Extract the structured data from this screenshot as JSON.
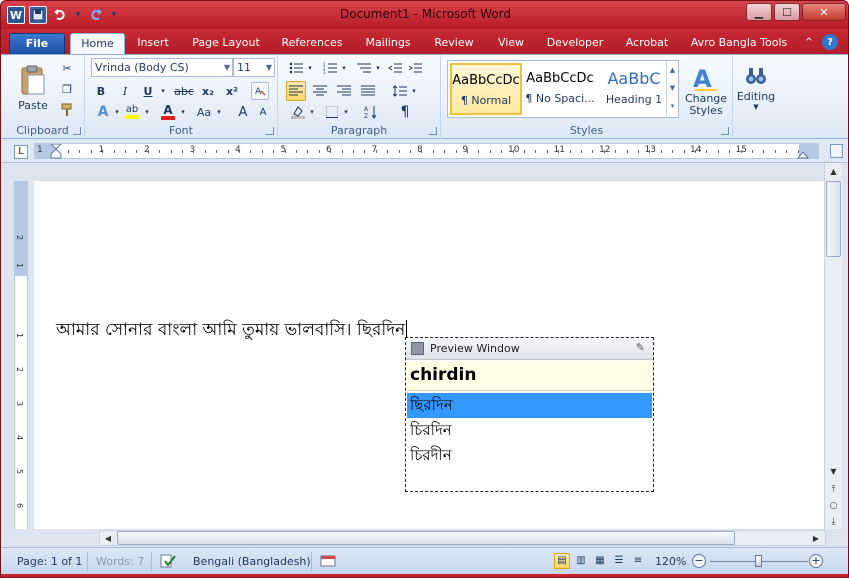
{
  "window": {
    "title": "Document1  -  Microsoft Word",
    "logo_letter": "W",
    "qat": [
      "save-icon",
      "undo-icon",
      "redo-icon",
      "customize-qat-icon"
    ],
    "controls": {
      "minimize": "▁",
      "maximize": "☐",
      "close": "✕"
    }
  },
  "tabs": [
    {
      "label": "File",
      "state": "file"
    },
    {
      "label": "Home",
      "state": "active"
    },
    {
      "label": "Insert"
    },
    {
      "label": "Page Layout"
    },
    {
      "label": "References"
    },
    {
      "label": "Mailings"
    },
    {
      "label": "Review"
    },
    {
      "label": "View"
    },
    {
      "label": "Developer"
    },
    {
      "label": "Acrobat"
    },
    {
      "label": "Avro Bangla Tools"
    }
  ],
  "ribbon": {
    "clipboard": {
      "label": "Clipboard",
      "paste": "Paste"
    },
    "font": {
      "label": "Font",
      "font_name": "Vrinda (Body CS)",
      "font_size": "11",
      "bold": "B",
      "italic": "I",
      "underline": "U",
      "strike": "abc",
      "subscript": "x₂",
      "superscript": "x²",
      "grow": "A",
      "shrink": "A",
      "change_case": "Aa",
      "highlight": "ab",
      "font_color": "A"
    },
    "paragraph": {
      "label": "Paragraph",
      "pilcrow": "¶"
    },
    "styles": {
      "label": "Styles",
      "items": [
        {
          "preview": "AaBbCcDc",
          "name": "¶ Normal"
        },
        {
          "preview": "AaBbCcDc",
          "name": "¶ No Spaci..."
        },
        {
          "preview": "AaBbC",
          "name": "Heading 1"
        }
      ],
      "change_styles": "Change\nStyles"
    },
    "editing": {
      "label": "Editing"
    }
  },
  "ruler": {
    "tab_selector": "L",
    "numbers": [
      "1",
      "1",
      "2",
      "3",
      "4",
      "5",
      "6",
      "7",
      "8",
      "9",
      "10",
      "11",
      "12",
      "13",
      "14",
      "15"
    ]
  },
  "document": {
    "text": "আমার সোনার বাংলা আমি তুমায় ভালবাসি। ছিরদিন"
  },
  "preview_window": {
    "title": "Preview Window",
    "input": "chirdin",
    "suggestions": [
      "ছিরদিন",
      "চিরদিন",
      "চিরদীন"
    ],
    "selected_index": 0
  },
  "status": {
    "page": "Page: 1 of 1",
    "words": "Words: 7",
    "language": "Bengali (Bangladesh)",
    "zoom": "120%",
    "zoom_minus": "−",
    "zoom_plus": "+"
  },
  "colors": {
    "title_bar": "#c8222c",
    "file_tab": "#2b5aa8",
    "selection": "#3399ff",
    "preview_input_bg": "#fffde6"
  }
}
